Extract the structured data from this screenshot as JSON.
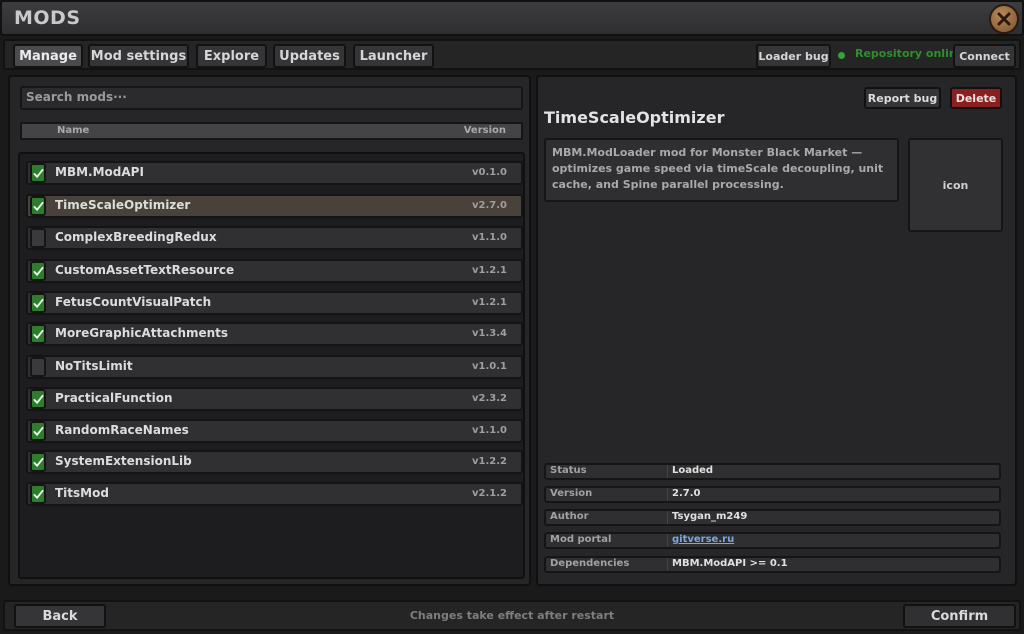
{
  "window": {
    "title": "MODS"
  },
  "tabs": [
    {
      "label": "Manage",
      "active": true
    },
    {
      "label": "Mod settings",
      "active": false
    },
    {
      "label": "Explore",
      "active": false
    },
    {
      "label": "Updates",
      "active": false
    },
    {
      "label": "Launcher",
      "active": false
    }
  ],
  "toolbar": {
    "loader_bug": "Loader bug",
    "status": "Repository online",
    "connect": "Connect"
  },
  "mod_list": {
    "search_placeholder": "Search mods···",
    "col_name": "Name",
    "col_version": "Version",
    "items": [
      {
        "name": "MBM.ModAPI",
        "version": "v0.1.0",
        "enabled": true
      },
      {
        "name": "TimeScaleOptimizer",
        "version": "v2.7.0",
        "enabled": true,
        "selected": true
      },
      {
        "name": "ComplexBreedingRedux",
        "version": "v1.1.0",
        "enabled": false
      },
      {
        "name": "CustomAssetTextResource",
        "version": "v1.2.1",
        "enabled": true
      },
      {
        "name": "FetusCountVisualPatch",
        "version": "v1.2.1",
        "enabled": true
      },
      {
        "name": "MoreGraphicAttachments",
        "version": "v1.3.4",
        "enabled": true
      },
      {
        "name": "NoTitsLimit",
        "version": "v1.0.1",
        "enabled": false
      },
      {
        "name": "PracticalFunction",
        "version": "v2.3.2",
        "enabled": true
      },
      {
        "name": "RandomRaceNames",
        "version": "v1.1.0",
        "enabled": true
      },
      {
        "name": "SystemExtensionLib",
        "version": "v1.2.2",
        "enabled": true
      },
      {
        "name": "TitsMod",
        "version": "v2.1.2",
        "enabled": true
      }
    ]
  },
  "detail": {
    "report_bug": "Report bug",
    "delete": "Delete",
    "title": "TimeScaleOptimizer",
    "description": "MBM.ModLoader mod for Monster Black Market — optimizes game speed via timeScale decoupling, unit cache, and Spine parallel processing.",
    "icon_placeholder": "icon",
    "info": [
      {
        "label": "Status",
        "value": "Loaded"
      },
      {
        "label": "Version",
        "value": "2.7.0"
      },
      {
        "label": "Author",
        "value": "Tsygan_m249"
      },
      {
        "label": "Mod portal",
        "value": "gitverse.ru",
        "link": true
      },
      {
        "label": "Dependencies",
        "value": "MBM.ModAPI >= 0.1"
      }
    ]
  },
  "footer": {
    "back": "Back",
    "hint": "Changes take effect after restart",
    "confirm": "Confirm"
  },
  "colors": {
    "accent_green": "#2e7d2e",
    "delete_red": "#8a1f1f",
    "link_blue": "#79a8e0",
    "status_green": "#2d8f2d"
  }
}
